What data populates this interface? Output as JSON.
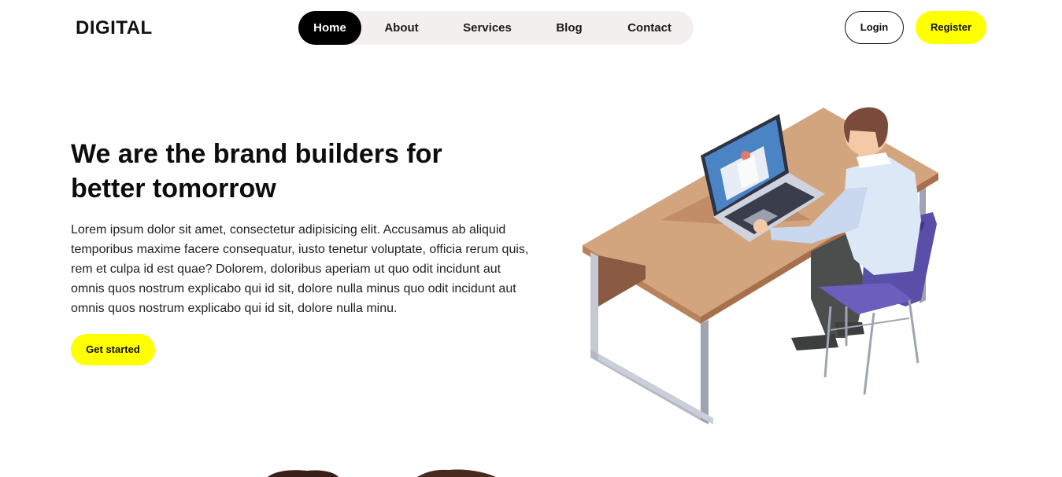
{
  "brand": {
    "logo": "DIGITAL"
  },
  "nav": {
    "items": [
      {
        "label": "Home",
        "active": true
      },
      {
        "label": "About",
        "active": false
      },
      {
        "label": "Services",
        "active": false
      },
      {
        "label": "Blog",
        "active": false
      },
      {
        "label": "Contact",
        "active": false
      }
    ]
  },
  "auth": {
    "login_label": "Login",
    "register_label": "Register"
  },
  "hero": {
    "title_line1": "We are the brand builders for",
    "title_line2": "better tomorrow",
    "paragraph": "Lorem ipsum dolor sit amet, consectetur adipisicing elit. Accusamus ab aliquid temporibus maxime facere consequatur, iusto tenetur voluptate, officia rerum quis, rem et culpa id est quae? Dolorem, doloribus aperiam ut quo odit incidunt aut omnis quos nostrum explicabo qui id sit, dolore nulla minus quo odit incidunt aut omnis quos nostrum explicabo qui id sit, dolore nulla minu.",
    "cta_label": "Get started"
  },
  "colors": {
    "accent": "#ffff00",
    "nav_bg": "#f3efee",
    "active_nav_bg": "#000000",
    "desk_top": "#d2a57f",
    "chair": "#5a4fa8",
    "laptop_screen": "#4a84c4"
  }
}
